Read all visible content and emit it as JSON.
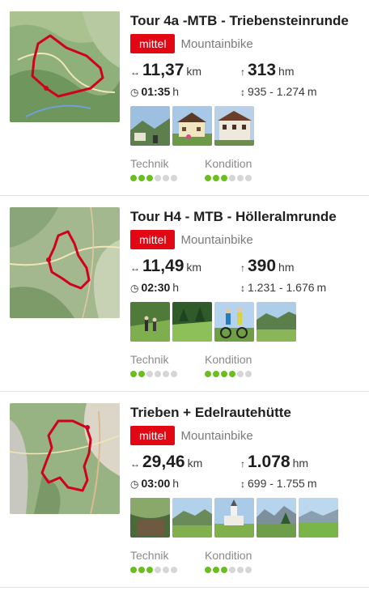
{
  "tours": [
    {
      "title": "Tour 4a -MTB - Triebensteinrunde",
      "difficulty": "mittel",
      "activity": "Mountainbike",
      "distance_value": "11,37",
      "distance_unit": "km",
      "ascent_value": "313",
      "ascent_unit": "hm",
      "duration_value": "01:35",
      "duration_unit": "h",
      "altitude_range": "935 - 1.274",
      "altitude_unit": "m",
      "technik_label": "Technik",
      "technik_level": 3,
      "kondition_label": "Kondition",
      "kondition_level": 3,
      "photo_count": 3
    },
    {
      "title": "Tour H4 - MTB - Hölleralmrunde",
      "difficulty": "mittel",
      "activity": "Mountainbike",
      "distance_value": "11,49",
      "distance_unit": "km",
      "ascent_value": "390",
      "ascent_unit": "hm",
      "duration_value": "02:30",
      "duration_unit": "h",
      "altitude_range": "1.231 - 1.676",
      "altitude_unit": "m",
      "technik_label": "Technik",
      "technik_level": 2,
      "kondition_label": "Kondition",
      "kondition_level": 4,
      "photo_count": 4
    },
    {
      "title": "Trieben + Edelrautehütte",
      "difficulty": "mittel",
      "activity": "Mountainbike",
      "distance_value": "29,46",
      "distance_unit": "km",
      "ascent_value": "1.078",
      "ascent_unit": "hm",
      "duration_value": "03:00",
      "duration_unit": "h",
      "altitude_range": "699 - 1.755",
      "altitude_unit": "m",
      "technik_label": "Technik",
      "technik_level": 3,
      "kondition_label": "Kondition",
      "kondition_level": 3,
      "photo_count": 5
    }
  ],
  "rating_max": 6,
  "icons": {
    "distance": "distance-arrows-icon",
    "ascent": "ascent-arrow-icon",
    "duration": "clock-icon",
    "altitude": "altitude-range-icon"
  },
  "colors": {
    "badge": "#e30613",
    "rating_on": "#6abf1e",
    "rating_off": "#d6d6d6",
    "route": "#d0021b"
  }
}
